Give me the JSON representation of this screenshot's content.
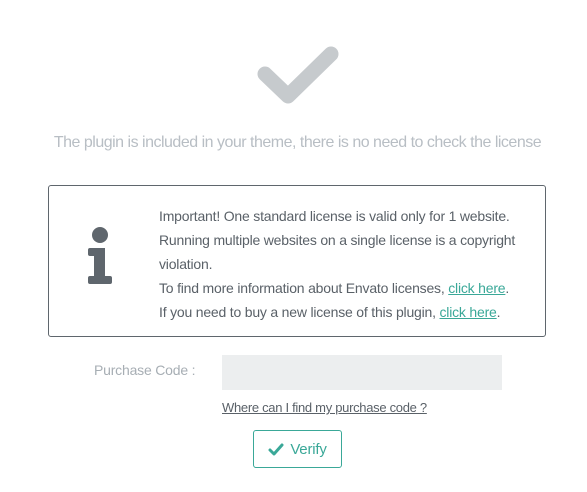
{
  "status": {
    "icon": "checkmark-icon",
    "message": "The plugin is included in your theme, there is no need to check the license"
  },
  "notice": {
    "icon": "info-icon",
    "line1": "Important! One standard license is valid only for 1 website.",
    "line2": "Running multiple websites on a single license is a copyright",
    "line3": "violation.",
    "line4_text": "To find more information about Envato licenses, ",
    "line4_link": "click here",
    "line4_end": ".",
    "line5_text": "If you need to buy a new license of this plugin, ",
    "line5_link": "click here",
    "line5_end": "."
  },
  "purchase": {
    "label": "Purchase Code :",
    "value": "",
    "placeholder": "",
    "help_link": "Where can I find my purchase code ?"
  },
  "verify": {
    "icon": "check-icon",
    "label": "Verify"
  },
  "colors": {
    "accent": "#3aa898",
    "muted_icon": "#c6cacd",
    "info_icon": "#5f666d",
    "headline": "#b8bec4",
    "input_bg": "#eceeef"
  }
}
